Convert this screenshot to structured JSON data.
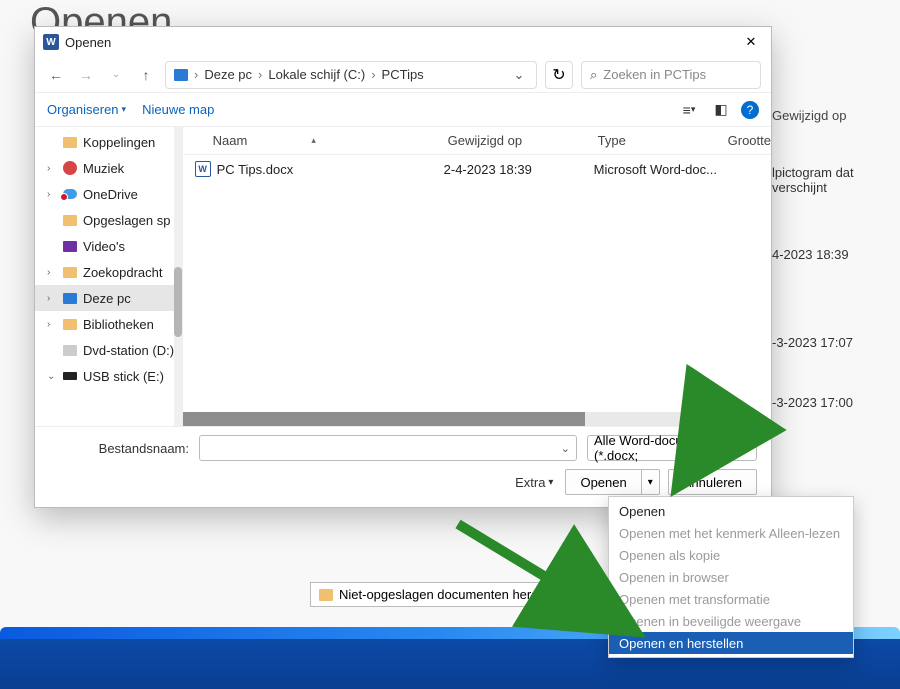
{
  "background": {
    "page_title": "Openen",
    "col_gewijzigd": "Gewijzigd op",
    "snippet": "lpictogram dat verschijnt",
    "dates": [
      "4-2023 18:39",
      "-3-2023 17:07",
      "-3-2023 17:00"
    ],
    "restore_button": "Niet-opgeslagen documenten herstellen"
  },
  "dialog": {
    "title": "Openen",
    "breadcrumb": [
      "Deze pc",
      "Lokale schijf (C:)",
      "PCTips"
    ],
    "search_placeholder": "Zoeken in PCTips",
    "toolbar": {
      "organiseren": "Organiseren",
      "nieuwe_map": "Nieuwe map"
    },
    "tree": [
      {
        "label": "Koppelingen",
        "icon": "fdr",
        "child": true
      },
      {
        "label": "Muziek",
        "icon": "mus",
        "expander": ">"
      },
      {
        "label": "OneDrive",
        "icon": "od",
        "expander": ">",
        "badge": true
      },
      {
        "label": "Opgeslagen sp",
        "icon": "fdr",
        "child": true
      },
      {
        "label": "Video's",
        "icon": "vid",
        "child": true
      },
      {
        "label": "Zoekopdracht",
        "icon": "fdr",
        "expander": ">"
      },
      {
        "label": "Deze pc",
        "icon": "pcmon",
        "expander": ">",
        "selected": true
      },
      {
        "label": "Bibliotheken",
        "icon": "fdr",
        "expander": ">"
      },
      {
        "label": "Dvd-station (D:)",
        "icon": "dvd",
        "child": true
      },
      {
        "label": "USB stick (E:)",
        "icon": "usb",
        "expander": "v"
      }
    ],
    "columns": {
      "naam": "Naam",
      "gewijzigd": "Gewijzigd op",
      "type": "Type",
      "grootte": "Grootte"
    },
    "files": [
      {
        "name": "PC Tips.docx",
        "modified": "2-4-2023 18:39",
        "type": "Microsoft Word-doc..."
      }
    ],
    "filename_label": "Bestandsnaam:",
    "filetype": "Alle Word-documenten (*.docx;",
    "extra_label": "Extra",
    "open_btn": "Openen",
    "cancel_btn": "Annuleren"
  },
  "dropdown": [
    {
      "label": "Openen",
      "state": "normal"
    },
    {
      "label": "Openen met het kenmerk Alleen-lezen",
      "state": "dis"
    },
    {
      "label": "Openen als kopie",
      "state": "dis"
    },
    {
      "label": "Openen in browser",
      "state": "dis"
    },
    {
      "label": "Openen met transformatie",
      "state": "dis"
    },
    {
      "label": "Openen in beveiligde weergave",
      "state": "dis"
    },
    {
      "label": "Openen en herstellen",
      "state": "hl"
    }
  ]
}
